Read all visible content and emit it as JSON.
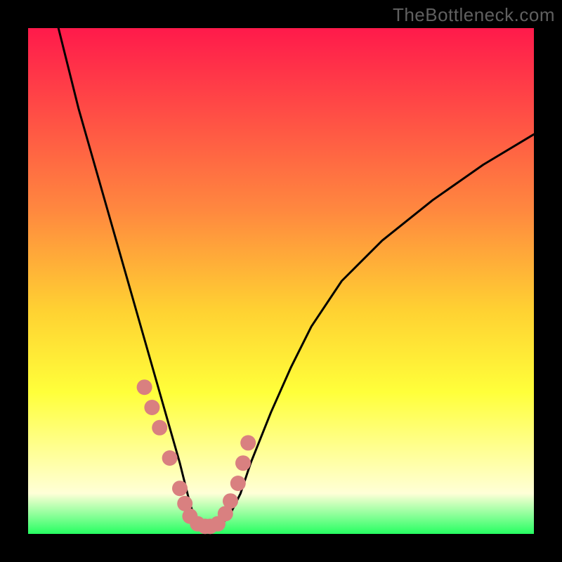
{
  "watermark": "TheBottleneck.com",
  "chart_data": {
    "type": "line",
    "title": "",
    "xlabel": "",
    "ylabel": "",
    "xlim": [
      0,
      100
    ],
    "ylim": [
      0,
      100
    ],
    "legend": null,
    "background_gradient": {
      "stops": [
        {
          "offset": 0.0,
          "color": "#ff1a4b"
        },
        {
          "offset": 0.36,
          "color": "#ff883f"
        },
        {
          "offset": 0.56,
          "color": "#ffd232"
        },
        {
          "offset": 0.72,
          "color": "#ffff3a"
        },
        {
          "offset": 0.83,
          "color": "#ffff90"
        },
        {
          "offset": 0.92,
          "color": "#ffffd7"
        },
        {
          "offset": 1.0,
          "color": "#26ff62"
        }
      ]
    },
    "series": [
      {
        "name": "bottleneck-curve",
        "color": "#000000",
        "x": [
          6,
          8,
          10,
          12,
          14,
          16,
          18,
          20,
          22,
          24,
          26,
          28,
          30,
          31,
          32,
          33,
          34,
          36,
          38,
          40,
          42,
          44,
          48,
          52,
          56,
          62,
          70,
          80,
          90,
          100
        ],
        "y": [
          100,
          92,
          84,
          77,
          70,
          63,
          56,
          49,
          42,
          35,
          28,
          21,
          14,
          10,
          6,
          3,
          1.5,
          1,
          1.5,
          4,
          8,
          14,
          24,
          33,
          41,
          50,
          58,
          66,
          73,
          79
        ]
      },
      {
        "name": "highlight-dots",
        "color": "#d98080",
        "type": "scatter",
        "x": [
          23.0,
          24.5,
          26.0,
          28.0,
          30.0,
          31.0,
          32.0,
          33.5,
          35.0,
          36.0,
          37.5,
          39.0,
          40.0,
          41.5,
          42.5,
          43.5
        ],
        "y": [
          29,
          25,
          21,
          15,
          9,
          6,
          3.5,
          2,
          1.5,
          1.5,
          2,
          4,
          6.5,
          10,
          14,
          18
        ]
      }
    ]
  }
}
